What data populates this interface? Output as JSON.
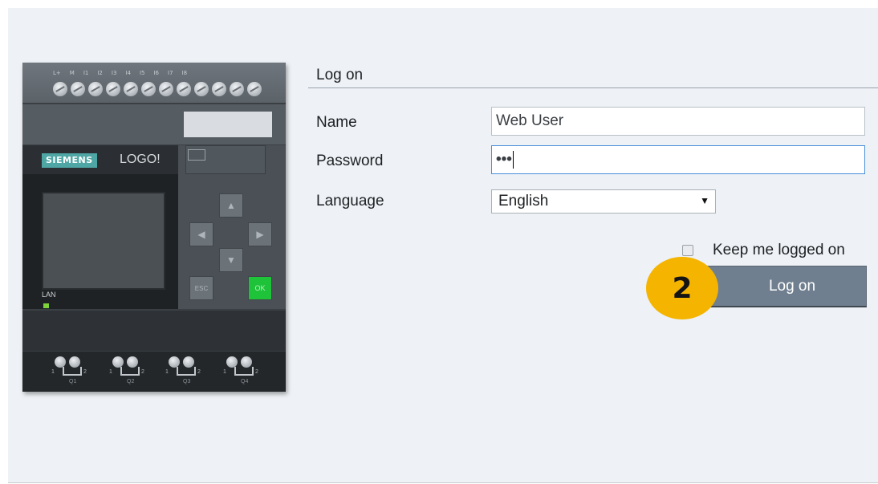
{
  "device": {
    "brand": "SIEMENS",
    "model": "LOGO!",
    "terminal_labels": [
      "L+",
      "M",
      "I1",
      "I2",
      "I3",
      "I4",
      "I5",
      "I6",
      "I7",
      "I8"
    ],
    "lan_label": "LAN",
    "keys": {
      "esc": "ESC",
      "ok": "OK"
    },
    "outputs": [
      {
        "left_num": "1",
        "right_num": "2",
        "label": "Q1"
      },
      {
        "left_num": "1",
        "right_num": "2",
        "label": "Q2"
      },
      {
        "left_num": "1",
        "right_num": "2",
        "label": "Q3"
      },
      {
        "left_num": "1",
        "right_num": "2",
        "label": "Q4"
      }
    ]
  },
  "form": {
    "title": "Log on",
    "name_label": "Name",
    "name_value": "Web User",
    "password_label": "Password",
    "password_value": "•••",
    "language_label": "Language",
    "language_value": "English",
    "keep_logged_label": "Keep me logged on",
    "keep_logged_checked": false,
    "logon_button": "Log on"
  },
  "annotation": {
    "step_badge": "2",
    "badge_color": "#f4b400"
  },
  "colors": {
    "button": "#6f7f8f",
    "panel": "#eef1f5",
    "accent_focus": "#4a90d9"
  }
}
